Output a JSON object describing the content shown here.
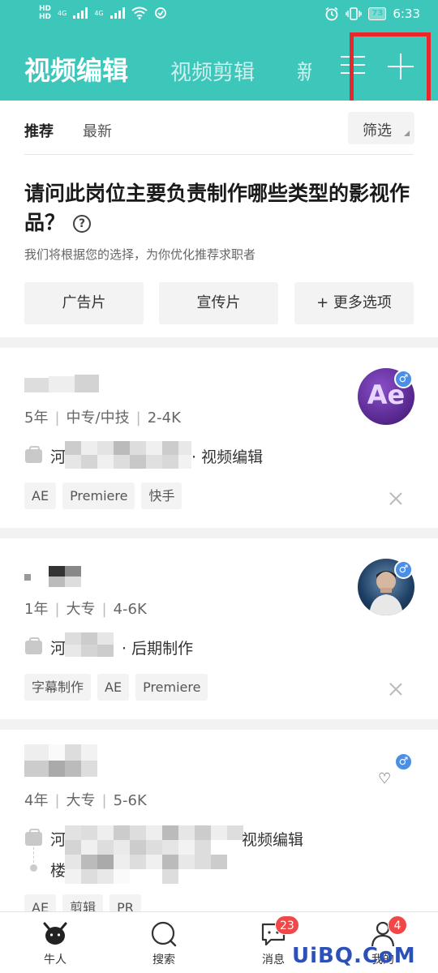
{
  "status_bar": {
    "battery": "73",
    "time": "6:33",
    "network_left": "HD",
    "network_sub": "4G"
  },
  "header": {
    "tabs": [
      {
        "label": "视频编辑",
        "active": true
      },
      {
        "label": "视频剪辑",
        "active": false
      },
      {
        "label": "新",
        "active": false
      }
    ],
    "accent_color": "#3cc7ba"
  },
  "filter_bar": {
    "recommend": "推荐",
    "latest": "最新",
    "filter": "筛选"
  },
  "question": {
    "title": "请问此岗位主要负责制作哪些类型的影视作品？",
    "help": "?",
    "subtitle": "我们将根据您的选择，为你优化推荐求职者",
    "options": [
      "广告片",
      "宣传片",
      "+ 更多选项"
    ]
  },
  "candidates": [
    {
      "experience": "5年",
      "education": "中专/中技",
      "salary": "2-4K",
      "job_prefix": "河",
      "job_suffix": "· 视频编辑",
      "tags": [
        "AE",
        "Premiere",
        "快手"
      ],
      "avatar_text": "Ae",
      "gender": "♂"
    },
    {
      "experience": "1年",
      "education": "大专",
      "salary": "4-6K",
      "job_prefix": "河",
      "job_suffix": "· 后期制作",
      "tags": [
        "字幕制作",
        "AE",
        "Premiere"
      ],
      "gender": "♂"
    },
    {
      "experience": "4年",
      "education": "大专",
      "salary": "5-6K",
      "job_prefix": "河",
      "job_suffix": "视频编辑",
      "job2_prefix": "楼",
      "tags": [
        "AE",
        "剪辑",
        "PR"
      ],
      "gender": "♂",
      "heart": "♡"
    }
  ],
  "bottom_nav": {
    "items": [
      {
        "label": "牛人"
      },
      {
        "label": "搜索"
      },
      {
        "label": "消息",
        "badge": "23"
      },
      {
        "label": "我的",
        "badge": "4"
      }
    ]
  },
  "watermark": "UiBQ.CoM"
}
